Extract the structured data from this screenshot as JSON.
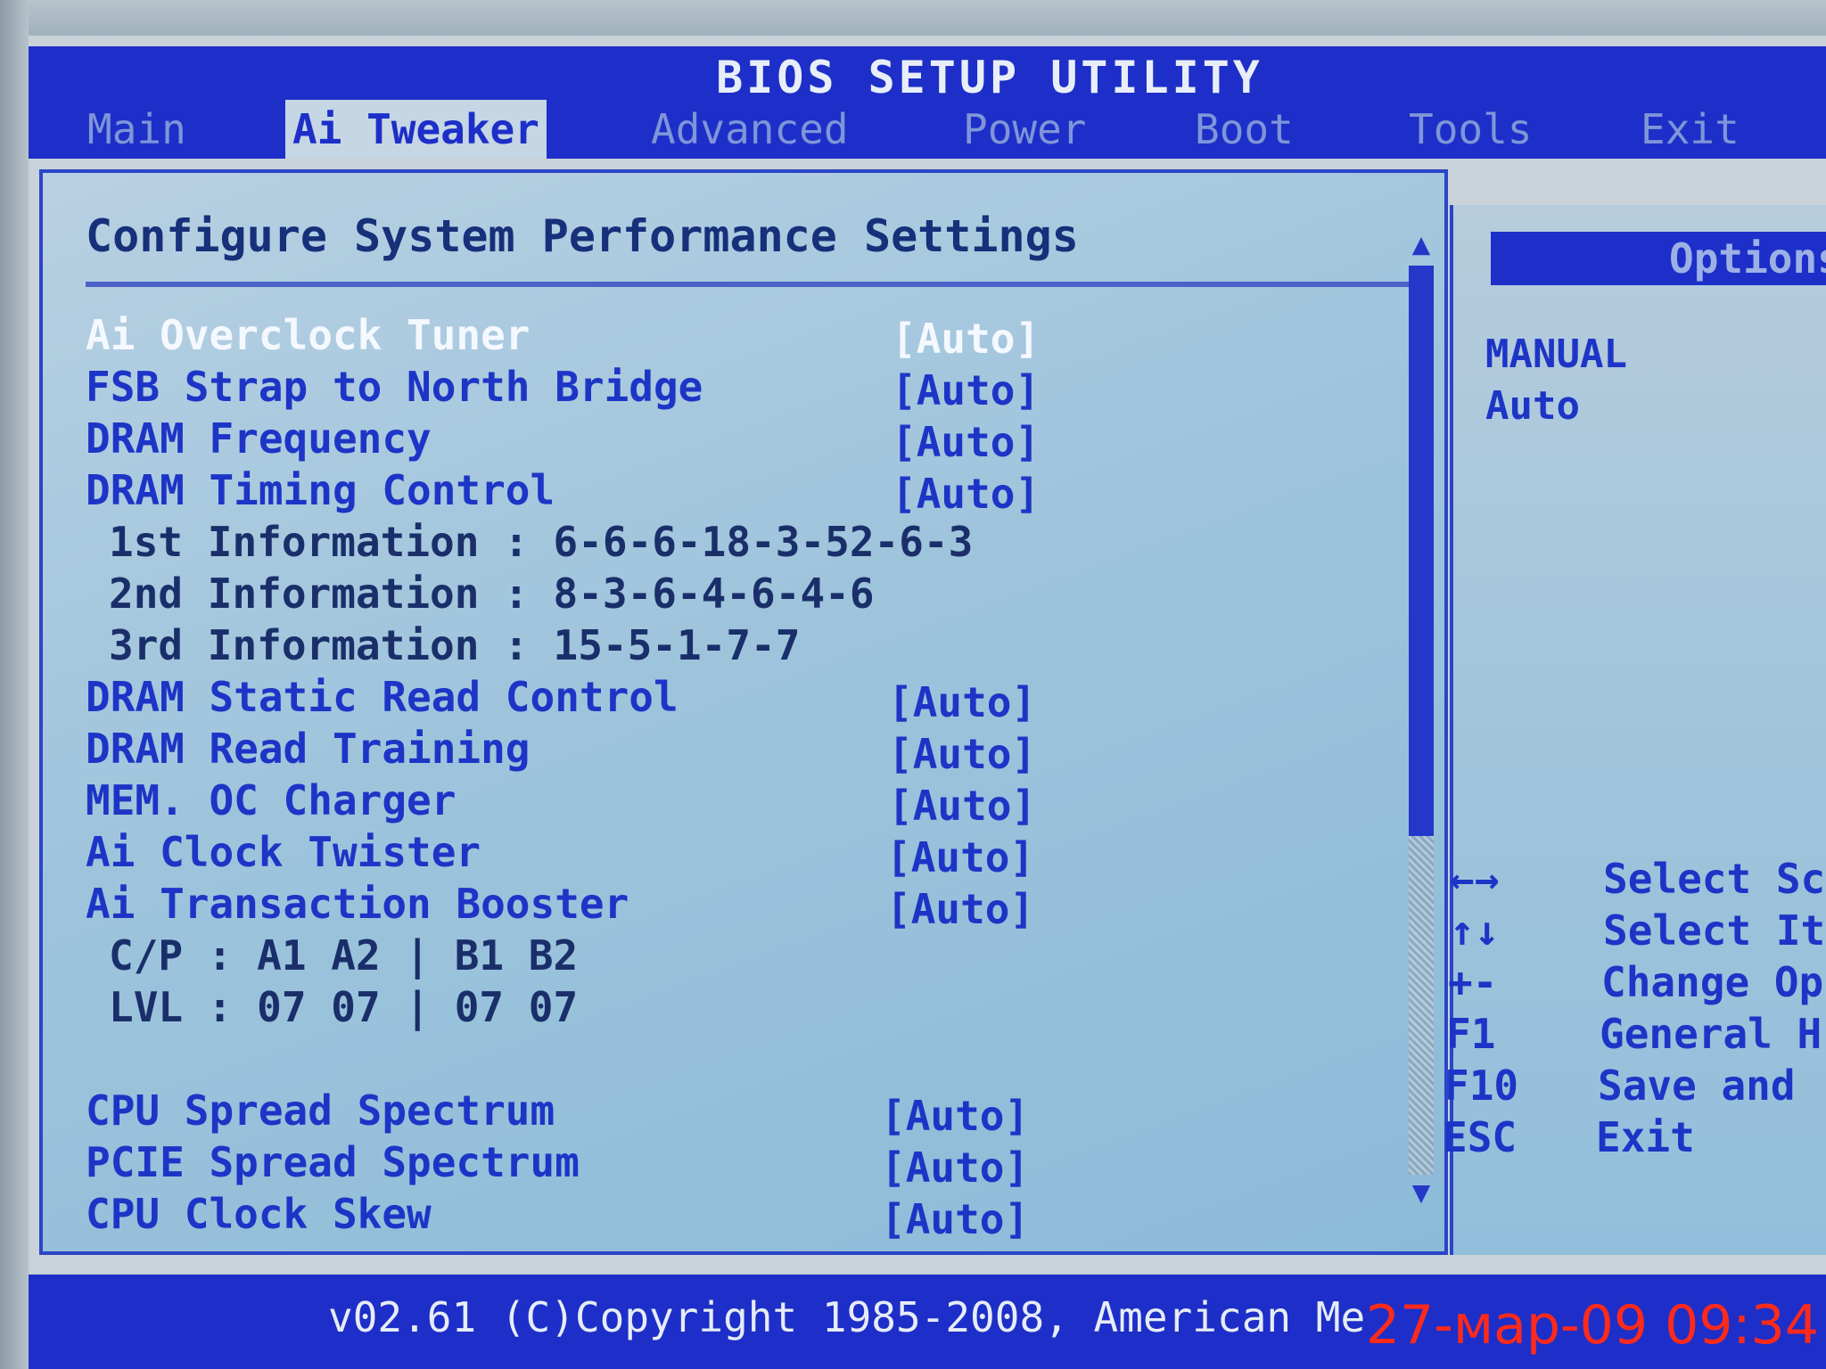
{
  "title": "BIOS SETUP UTILITY",
  "tabs": [
    {
      "label": "Main"
    },
    {
      "label": "Ai Tweaker"
    },
    {
      "label": "Advanced"
    },
    {
      "label": "Power"
    },
    {
      "label": "Boot"
    },
    {
      "label": "Tools"
    },
    {
      "label": "Exit"
    }
  ],
  "active_tab": "Ai Tweaker",
  "heading": "Configure System Performance Settings",
  "settings": [
    {
      "label": "Ai Overclock Tuner",
      "value": "[Auto]"
    },
    {
      "label": "FSB Strap to North Bridge",
      "value": "[Auto]"
    },
    {
      "label": "DRAM Frequency",
      "value": "[Auto]"
    },
    {
      "label": "DRAM Timing Control",
      "value": "[Auto]"
    },
    {
      "label": "1st Information : 6-6-6-18-3-52-6-3"
    },
    {
      "label": "2nd Information : 8-3-6-4-6-4-6"
    },
    {
      "label": "3rd Information : 15-5-1-7-7"
    },
    {
      "label": "DRAM Static Read Control",
      "value": "[Auto]"
    },
    {
      "label": "DRAM Read Training",
      "value": "[Auto]"
    },
    {
      "label": "MEM. OC Charger",
      "value": "[Auto]"
    },
    {
      "label": "Ai Clock Twister",
      "value": "[Auto]"
    },
    {
      "label": "Ai Transaction Booster",
      "value": "[Auto]"
    },
    {
      "label": "C/P : A1 A2 | B1 B2"
    },
    {
      "label": "LVL : 07 07 | 07 07"
    },
    {
      "label": "CPU Spread Spectrum",
      "value": "[Auto]"
    },
    {
      "label": "PCIE Spread Spectrum",
      "value": "[Auto]"
    },
    {
      "label": "CPU Clock Skew",
      "value": "[Auto]"
    }
  ],
  "options_title": "Options",
  "options": [
    "MANUAL",
    "Auto"
  ],
  "help": [
    {
      "key": "←→",
      "desc": "Select Sc"
    },
    {
      "key": "↑↓",
      "desc": "Select It"
    },
    {
      "key": "+-",
      "desc": "Change Op"
    },
    {
      "key": "F1",
      "desc": "General H"
    },
    {
      "key": "F10",
      "desc": "Save and "
    },
    {
      "key": "ESC",
      "desc": "Exit"
    }
  ],
  "footer": "v02.61 (C)Copyright 1985-2008, American Me",
  "timestamp": "27-мар-09 09:34",
  "colors": {
    "bios_blue": "#1d2fc8",
    "panel_bg": "#9ec4dc",
    "selected_text": "#f4f8ff",
    "timestamp": "#ff2a1a"
  }
}
